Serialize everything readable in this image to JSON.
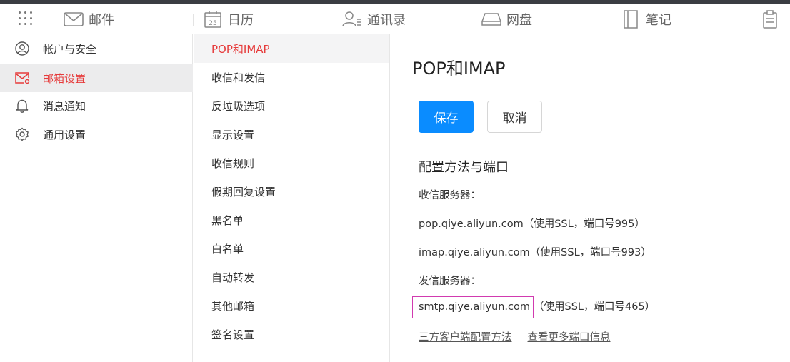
{
  "topnav": {
    "items": [
      {
        "label": "邮件",
        "icon": "mail-icon"
      },
      {
        "label": "日历",
        "icon": "calendar-icon",
        "icon_text": "25"
      },
      {
        "label": "通讯录",
        "icon": "contacts-icon"
      },
      {
        "label": "网盘",
        "icon": "disk-icon"
      },
      {
        "label": "笔记",
        "icon": "notes-icon"
      },
      {
        "label": "",
        "icon": "clipboard-icon"
      }
    ]
  },
  "sidebar": {
    "items": [
      {
        "label": "帐户与安全",
        "icon": "user-icon"
      },
      {
        "label": "邮箱设置",
        "icon": "mail-settings-icon"
      },
      {
        "label": "消息通知",
        "icon": "bell-icon"
      },
      {
        "label": "通用设置",
        "icon": "gear-icon"
      }
    ]
  },
  "submenu": {
    "items": [
      "POP和IMAP",
      "收信和发信",
      "反垃圾选项",
      "显示设置",
      "收信规则",
      "假期回复设置",
      "黑名单",
      "白名单",
      "自动转发",
      "其他邮箱",
      "签名设置"
    ]
  },
  "main": {
    "title": "POP和IMAP",
    "save_label": "保存",
    "cancel_label": "取消",
    "section_title": "配置方法与端口",
    "incoming_label": "收信服务器：",
    "pop_host": "pop.qiye.aliyun.com",
    "pop_note": "（使用SSL，端口号995）",
    "imap_host": "imap.qiye.aliyun.com",
    "imap_note": "（使用SSL，端口号993）",
    "outgoing_label": "发信服务器：",
    "smtp_host": "smtp.qiye.aliyun.com",
    "smtp_note": "（使用SSL，端口号465）",
    "link_client": "三方客户端配置方法",
    "link_ports": "查看更多端口信息"
  },
  "colors": {
    "accent_red": "#e63b3b",
    "primary_blue": "#0a8cff",
    "highlight_border": "#d13ab0"
  }
}
